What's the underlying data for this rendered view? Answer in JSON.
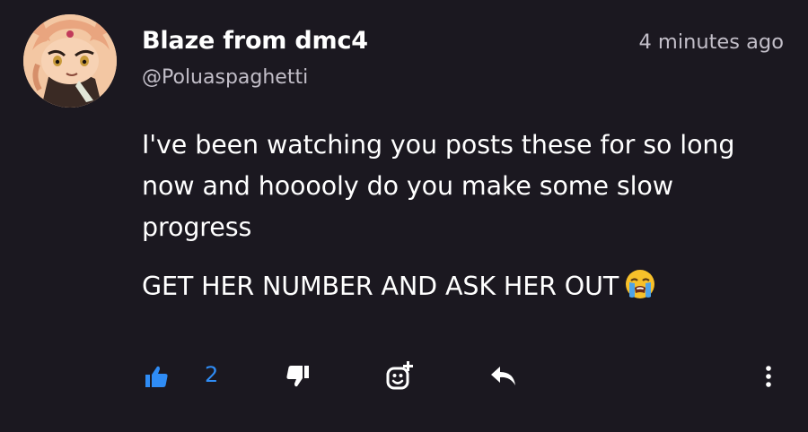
{
  "comment": {
    "author": "Blaze from dmc4",
    "handle": "@Poluaspaghetti",
    "timestamp": "4 minutes ago",
    "paragraphs": [
      "I've been watching you posts these for so long now and hooooly do you make some slow progress",
      "GET HER NUMBER AND ASK HER OUT"
    ],
    "emoji": "loudly-crying-face"
  },
  "actions": {
    "like_count": "2",
    "like_icon": "thumbs-up-icon",
    "dislike_icon": "thumbs-down-icon",
    "react_icon": "add-reaction-icon",
    "reply_icon": "reply-arrow-icon",
    "more_icon": "vertical-dots-icon"
  },
  "colors": {
    "background": "#1b1820",
    "text": "#ffffff",
    "muted": "#c2bec8",
    "accent": "#2f8cf5"
  }
}
